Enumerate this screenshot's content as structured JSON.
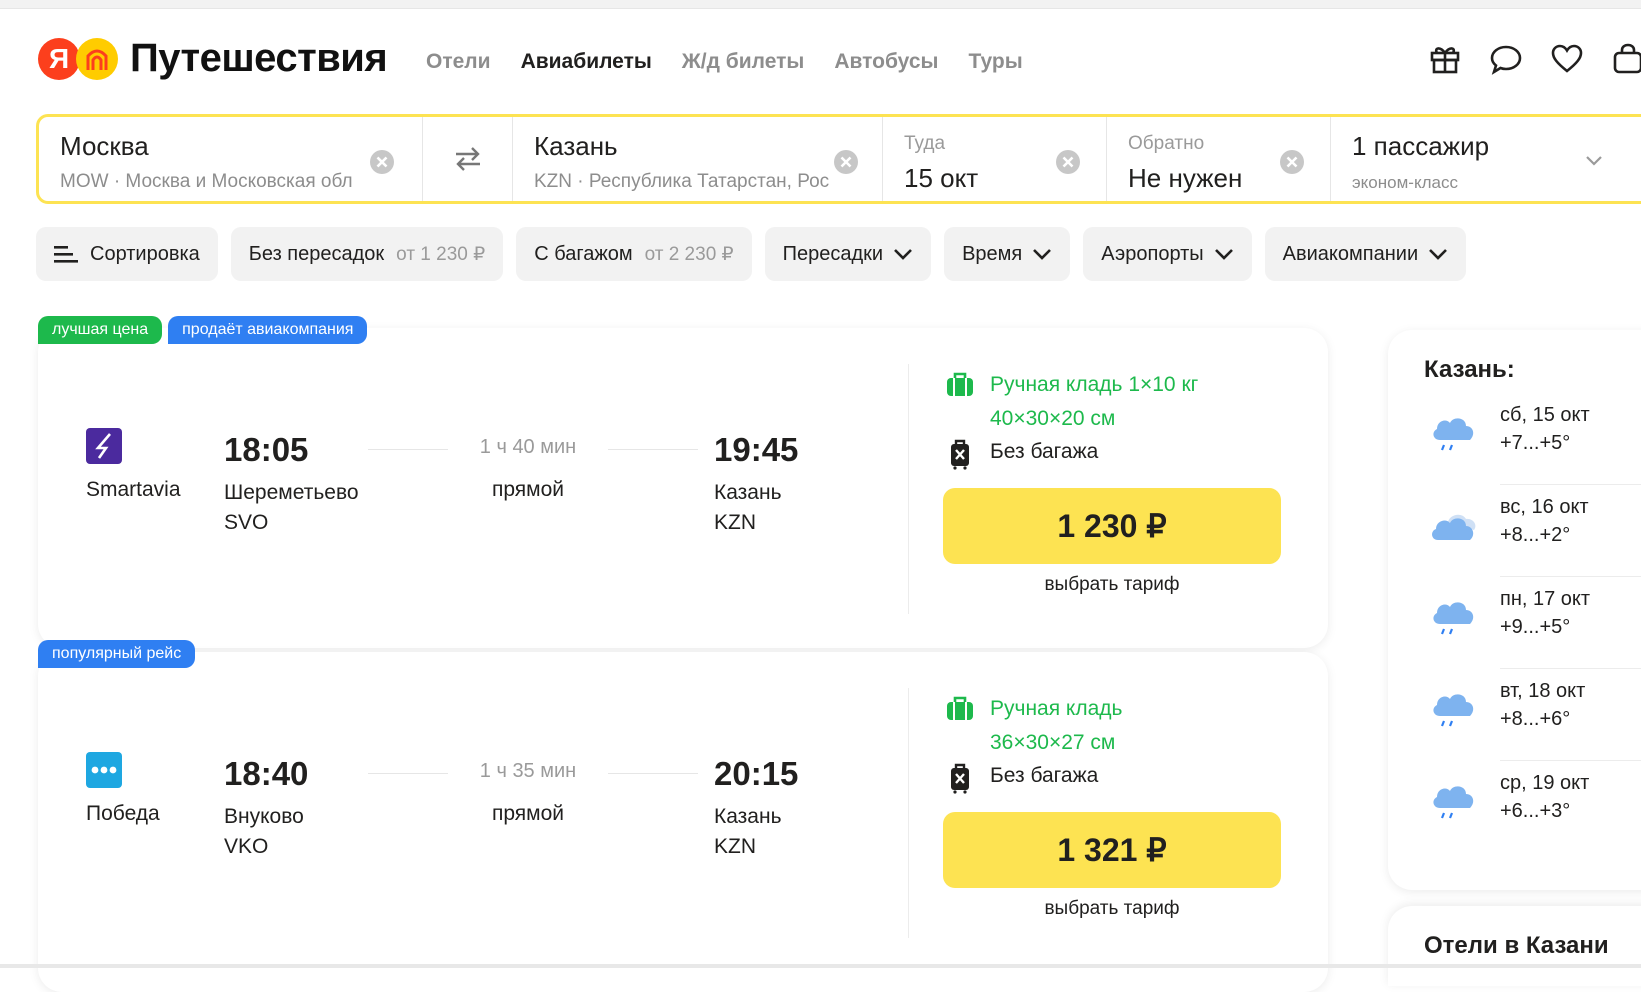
{
  "header": {
    "logo_letter": "Я",
    "title": "Путешествия",
    "nav": [
      {
        "label": "Отели",
        "active": false
      },
      {
        "label": "Авиабилеты",
        "active": true
      },
      {
        "label": "Ж/д билеты",
        "active": false
      },
      {
        "label": "Автобусы",
        "active": false
      },
      {
        "label": "Туры",
        "active": false
      }
    ],
    "icons": [
      "gift-icon",
      "chat-icon",
      "heart-icon",
      "bag-icon"
    ]
  },
  "search": {
    "from": {
      "city": "Москва",
      "details": "MOW · Москва и Московская обл"
    },
    "to": {
      "city": "Казань",
      "details": "KZN · Республика Татарстан, Рос"
    },
    "depart": {
      "label": "Туда",
      "value": "15 окт"
    },
    "return": {
      "label": "Обратно",
      "value": "Не нужен"
    },
    "passengers": {
      "value": "1 пассажир",
      "class": "эконом-класс"
    }
  },
  "filters": {
    "sort": "Сортировка",
    "direct": {
      "label": "Без пересадок",
      "from": "от 1 230 ₽"
    },
    "baggage": {
      "label": "С багажом",
      "from": "от 2 230 ₽"
    },
    "transfers": "Пересадки",
    "time": "Время",
    "airports": "Аэропорты",
    "airlines": "Авиакомпании"
  },
  "flights": [
    {
      "badges": [
        "лучшая цена",
        "продаёт авиакомпания"
      ],
      "airline": "Smartavia",
      "dep_time": "18:05",
      "dep_airport": "Шереметьево",
      "dep_code": "SVO",
      "duration": "1 ч 40 мин",
      "stops": "прямой",
      "arr_time": "19:45",
      "arr_city": "Казань",
      "arr_code": "KZN",
      "hand_luggage_1": "Ручная кладь 1×10 кг",
      "hand_luggage_2": "40×30×20 см",
      "baggage": "Без багажа",
      "price": "1 230 ₽",
      "select": "выбрать тариф"
    },
    {
      "badges": [
        "популярный рейс"
      ],
      "airline": "Победа",
      "dep_time": "18:40",
      "dep_airport": "Внуково",
      "dep_code": "VKO",
      "duration": "1 ч 35 мин",
      "stops": "прямой",
      "arr_time": "20:15",
      "arr_city": "Казань",
      "arr_code": "KZN",
      "hand_luggage_1": "Ручная кладь",
      "hand_luggage_2": "36×30×27 см",
      "baggage": "Без багажа",
      "price": "1 321 ₽",
      "select": "выбрать тариф"
    }
  ],
  "weather": {
    "title": "Казань:",
    "days": [
      {
        "day": "сб, 15 окт",
        "temp": "+7...+5°",
        "icon": "rain-cloud-icon"
      },
      {
        "day": "вс, 16 окт",
        "temp": "+8...+2°",
        "icon": "cloud-icon"
      },
      {
        "day": "пн, 17 окт",
        "temp": "+9...+5°",
        "icon": "rain-cloud-icon"
      },
      {
        "day": "вт, 18 окт",
        "temp": "+8...+6°",
        "icon": "rain-cloud-icon"
      },
      {
        "day": "ср, 19 окт",
        "temp": "+6...+3°",
        "icon": "rain-cloud-icon"
      }
    ]
  },
  "hotels": {
    "title": "Отели в Казани"
  },
  "colors": {
    "accent": "#fde352",
    "green": "#1db94c",
    "blue": "#2f7ff2",
    "logo_red": "#fc3f1d",
    "logo_yellow": "#ffcc00"
  }
}
